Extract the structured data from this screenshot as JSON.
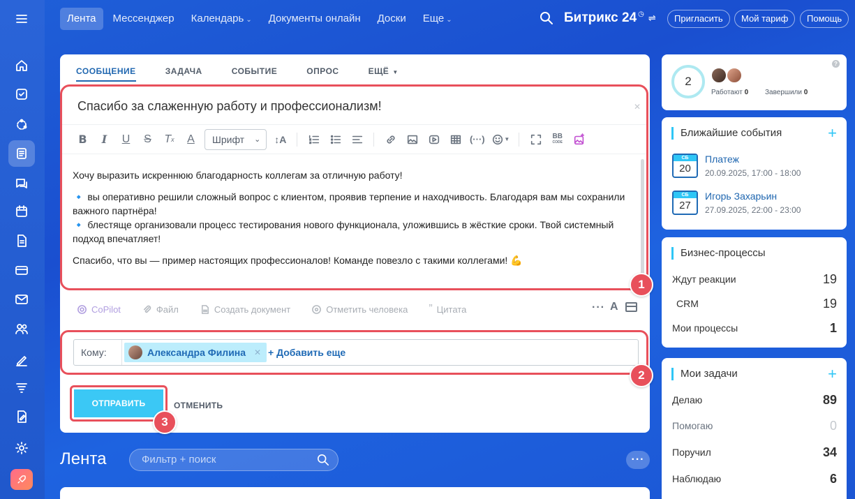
{
  "nav": {
    "items": [
      {
        "label": "Лента",
        "active": true
      },
      {
        "label": "Мессенджер"
      },
      {
        "label": "Календарь",
        "dropdown": true
      },
      {
        "label": "Документы онлайн"
      },
      {
        "label": "Доски"
      },
      {
        "label": "Еще",
        "dropdown": true
      }
    ],
    "brand": "Битрикс 24",
    "buttons": {
      "invite": "Пригласить",
      "tariff": "Мой тариф",
      "help": "Помощь"
    }
  },
  "composer": {
    "tabs": [
      "СООБЩЕНИЕ",
      "ЗАДАЧА",
      "СОБЫТИЕ",
      "ОПРОС",
      "ЕЩЁ"
    ],
    "title": "Спасибо за слаженную работу и профессионализм!",
    "font_select": "Шрифт",
    "body": [
      "Хочу выразить искреннюю благодарность коллегам за отличную работу!",
      "🔹 вы оперативно решили сложный вопрос с клиентом, проявив терпение и находчивость. Благодаря вам мы сохранили важного партнёра!",
      "🔹 блестяще организовали процесс тестирования нового функционала, уложившись в жёсткие сроки. Твой системный подход впечатляет!",
      "Спасибо, что вы — пример настоящих профессионалов! Команде повезло с такими коллегами! 💪"
    ],
    "actions": {
      "copilot": "CoPilot",
      "file": "Файл",
      "create_doc": "Создать документ",
      "mention": "Отметить человека",
      "quote": "Цитата"
    },
    "to_label": "Кому:",
    "recipient": "Александра Филина",
    "add_more": "+ Добавить еще",
    "send": "ОТПРАВИТЬ",
    "cancel": "ОТМЕНИТЬ",
    "step_badges": [
      "1",
      "2",
      "3"
    ]
  },
  "feed": {
    "title": "Лента",
    "search_placeholder": "Фильтр + поиск"
  },
  "presence": {
    "count": "2",
    "working_label": "Работают",
    "working": "0",
    "done_label": "Завершили",
    "done": "0"
  },
  "events": {
    "title": "Ближайшие события",
    "items": [
      {
        "weekday": "СБ",
        "day": "20",
        "name": "Платеж",
        "time": "20.09.2025, 17:00 - 18:00"
      },
      {
        "weekday": "СБ",
        "day": "27",
        "name": "Игорь Захарьин",
        "time": "27.09.2025, 22:00 - 23:00"
      }
    ]
  },
  "bp": {
    "title": "Бизнес-процессы",
    "rows": [
      {
        "label": "Ждут реакции",
        "value": "19"
      },
      {
        "label": "CRM",
        "value": "19"
      },
      {
        "label": "Мои процессы",
        "value": "1"
      }
    ]
  },
  "tasks": {
    "title": "Мои задачи",
    "rows": [
      {
        "label": "Делаю",
        "value": "89"
      },
      {
        "label": "Помогаю",
        "value": "0"
      },
      {
        "label": "Поручил",
        "value": "34"
      },
      {
        "label": "Наблюдаю",
        "value": "6"
      }
    ]
  },
  "colors": {
    "accent": "#2fc6f6",
    "highlight": "#e8505b",
    "link": "#2067b0"
  }
}
